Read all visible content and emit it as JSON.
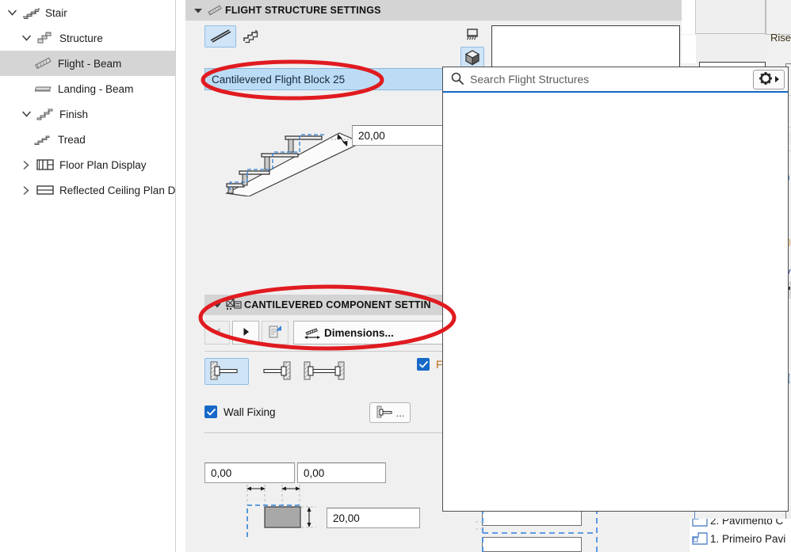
{
  "tree": {
    "items": [
      {
        "label": "Stair",
        "icon": "stair-icon",
        "depth": 0,
        "expanded": true,
        "selected": false,
        "has_children": true
      },
      {
        "label": "Structure",
        "icon": "structure-icon",
        "depth": 1,
        "expanded": true,
        "selected": false,
        "has_children": true
      },
      {
        "label": "Flight - Beam",
        "icon": "flight-beam-icon",
        "depth": 2,
        "expanded": null,
        "selected": true,
        "has_children": false
      },
      {
        "label": "Landing - Beam",
        "icon": "landing-beam-icon",
        "depth": 2,
        "expanded": null,
        "selected": false,
        "has_children": false
      },
      {
        "label": "Finish",
        "icon": "finish-icon",
        "depth": 1,
        "expanded": true,
        "selected": false,
        "has_children": true
      },
      {
        "label": "Tread",
        "icon": "tread-icon",
        "depth": 2,
        "expanded": null,
        "selected": false,
        "has_children": false
      },
      {
        "label": "Floor Plan Display",
        "icon": "floor-plan-icon",
        "depth": 1,
        "expanded": false,
        "selected": false,
        "has_children": true
      },
      {
        "label": "Reflected Ceiling Plan Disp",
        "icon": "ceiling-plan-icon",
        "depth": 1,
        "expanded": false,
        "selected": false,
        "has_children": true
      }
    ]
  },
  "flight_structure": {
    "header_title": "FLIGHT STRUCTURE SETTINGS",
    "header_icon": "flight-structure-icon",
    "type_buttons": [
      {
        "name": "monolith-type-button",
        "icon": "diagonal-slab-icon",
        "selected": true
      },
      {
        "name": "stepped-type-button",
        "icon": "stepped-stair-icon",
        "selected": false
      }
    ],
    "view_buttons": [
      {
        "name": "section-view-button",
        "icon": "section-view-icon",
        "selected": false
      },
      {
        "name": "3d-view-button",
        "icon": "cube-3d-icon",
        "selected": true
      }
    ],
    "structure_combo_value": "Cantilevered Flight Block 25",
    "thickness_value": "20,00"
  },
  "search_popup": {
    "placeholder": "Search Flight Structures",
    "search_icon": "search-icon",
    "settings_icon": "gear-icon",
    "settings_caret_icon": "caret-right-icon"
  },
  "cantilevered": {
    "header_title": "CANTILEVERED COMPONENT SETTIN",
    "header_icon": "cantilevered-component-icon",
    "nav_prev_icon": "triangle-left-icon",
    "nav_next_icon": "triangle-right-icon",
    "copy_icon": "copy-settings-icon",
    "dimensions_label": "Dimensions...",
    "dimensions_icon": "dimensions-icon",
    "fixing_type_buttons": [
      {
        "name": "fixing-left-wall-button",
        "icon": "cantilever-left-icon",
        "selected": true
      },
      {
        "name": "fixing-right-wall-button",
        "icon": "cantilever-right-icon",
        "selected": false
      },
      {
        "name": "fixing-both-walls-button",
        "icon": "cantilever-both-icon",
        "selected": false
      }
    ],
    "truncated_checkbox_label": "F",
    "wall_fixing_label": "Wall Fixing",
    "wall_fixing_checked": true,
    "wall_fixing_button_icon": "wall-fixing-detail-icon",
    "wall_fixing_button_label": "...",
    "offset_left_value": "0,00",
    "offset_right_value": "0,00",
    "block_height_value": "20,00"
  },
  "background": {
    "rise_label": "Rise",
    "levels": [
      {
        "label": "2. Pavimento C",
        "icon": "level-icon"
      },
      {
        "label": "1. Primeiro Pavi",
        "icon": "level-icon"
      }
    ]
  },
  "annotations": {
    "ellipse_color": "#e01b20",
    "ellipses": [
      {
        "name": "annotation-ellipse-structure-combo"
      },
      {
        "name": "annotation-ellipse-cantilevered-header"
      }
    ]
  }
}
